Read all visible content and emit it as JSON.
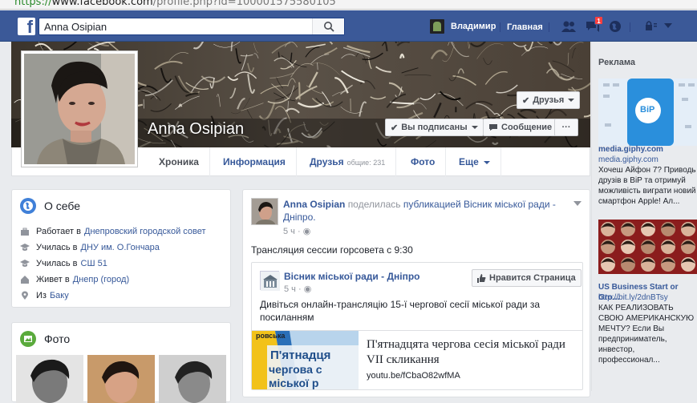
{
  "browser": {
    "url_proto": "https://",
    "url_host": "www.facebook.com",
    "url_rest": "/profile.php?id=100001575580105"
  },
  "topbar": {
    "search_value": "Anna Osipian",
    "user_name": "Владимир",
    "home_label": "Главная",
    "notif_count": "1"
  },
  "profile": {
    "name": "Anna Osipian",
    "friends_btn": "Друзья",
    "following_btn": "Вы подписаны",
    "message_btn": "Сообщение",
    "more_btn": "···"
  },
  "nav": {
    "tabs": [
      {
        "label": "Хроника"
      },
      {
        "label": "Информация"
      },
      {
        "label": "Друзья",
        "count": "общие: 231"
      },
      {
        "label": "Фото"
      },
      {
        "label": "Еще"
      }
    ]
  },
  "about": {
    "title": "О себе",
    "rows": [
      {
        "prefix": "Работает в",
        "link": "Днепровский городской совет"
      },
      {
        "prefix": "Училась в",
        "link": "ДНУ им. О.Гончара"
      },
      {
        "prefix": "Училась в",
        "link": "СШ 51"
      },
      {
        "prefix": "Живет в",
        "link": "Днепр (город)"
      },
      {
        "prefix": "Из",
        "link": "Баку"
      }
    ]
  },
  "photos": {
    "title": "Фото"
  },
  "post": {
    "author": "Anna Osipian",
    "action": "поделилась",
    "target": "публикацией Вiсник міської ради - Дніпро.",
    "time": "5 ч ·",
    "text": "Трансляция сессии горсовета с 9:30",
    "shared": {
      "page_name": "Вісник міської ради - Дніпро",
      "time": "5 ч ·",
      "like_btn": "Нравится Страница",
      "text": "Дивіться онлайн-трансляцію 15-ї чергової сесії міської ради за посиланням",
      "link_title": "П'ятнадцята чергова сесія міської ради VII скликання",
      "link_domain": "youtu.be/fCbaO82wfMA",
      "thumb_text_1": "ровська",
      "thumb_text_2": "П'ятнадця",
      "thumb_text_3": "чергова с",
      "thumb_text_4": "міської р"
    }
  },
  "ads": {
    "title": "Реклама",
    "ad1": {
      "domain_bold": "media.giphy.com",
      "domain": "media.giphy.com",
      "body": "Хочеш Айфон 7? Приводь друзів в BiP та отримуй можливість виграти новий смартфон Apple! Ал...",
      "logo": "BiP"
    },
    "ad2": {
      "title": "US Business Start or Gro...",
      "link": "http://bit.ly/2dnBTsy",
      "body": "КАК РЕАЛИЗОВАТЬ СВОЮ АМЕРИКАНСКУЮ МЕЧТУ? Если Вы предприниматель, инвестор, профессионал..."
    }
  },
  "colors": {
    "fb_blue": "#3b5998",
    "link": "#365899",
    "bg": "#e9ebee"
  }
}
